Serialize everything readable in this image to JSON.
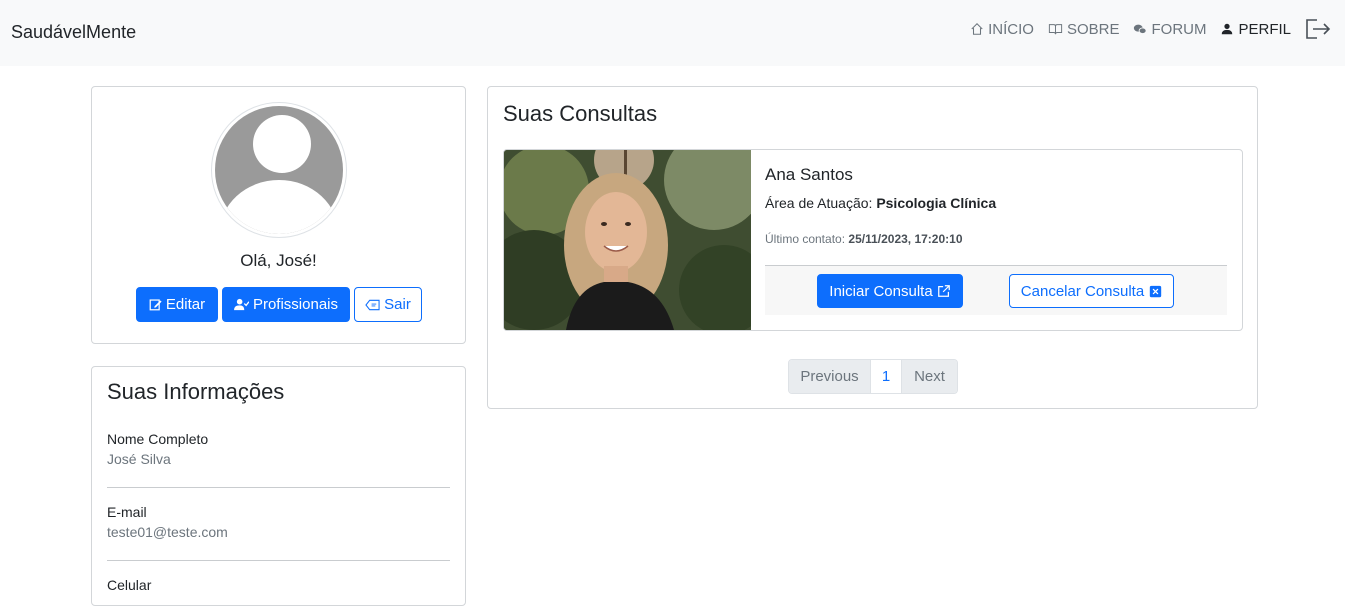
{
  "nav": {
    "brand": "SaudávelMente",
    "links": [
      {
        "label": "INÍCIO",
        "icon": "house-icon"
      },
      {
        "label": "SOBRE",
        "icon": "book-icon"
      },
      {
        "label": "FORUM",
        "icon": "chat-icon"
      },
      {
        "label": "PERFIL",
        "icon": "person-icon"
      }
    ],
    "logout_icon": "logout-icon"
  },
  "profile": {
    "greeting": "Olá, José!",
    "buttons": {
      "edit": "Editar",
      "professionals": "Profissionais",
      "logout": "Sair"
    }
  },
  "info": {
    "title": "Suas Informações",
    "items": [
      {
        "label": "Nome Completo",
        "value": "José Silva"
      },
      {
        "label": "E-mail",
        "value": "teste01@teste.com"
      },
      {
        "label": "Celular",
        "value": ""
      }
    ]
  },
  "consultations": {
    "title": "Suas Consultas",
    "items": [
      {
        "name": "Ana Santos",
        "area_label": "Área de Atuação:",
        "area_value": "Psicologia Clínica",
        "contact_label": "Último contato:",
        "contact_value": "25/11/2023, 17:20:10",
        "start_label": "Iniciar Consulta",
        "cancel_label": "Cancelar Consulta"
      }
    ],
    "pagination": {
      "previous": "Previous",
      "page": "1",
      "next": "Next"
    }
  },
  "colors": {
    "primary": "#0d6efd",
    "navbar_bg": "#f8f9fa"
  }
}
